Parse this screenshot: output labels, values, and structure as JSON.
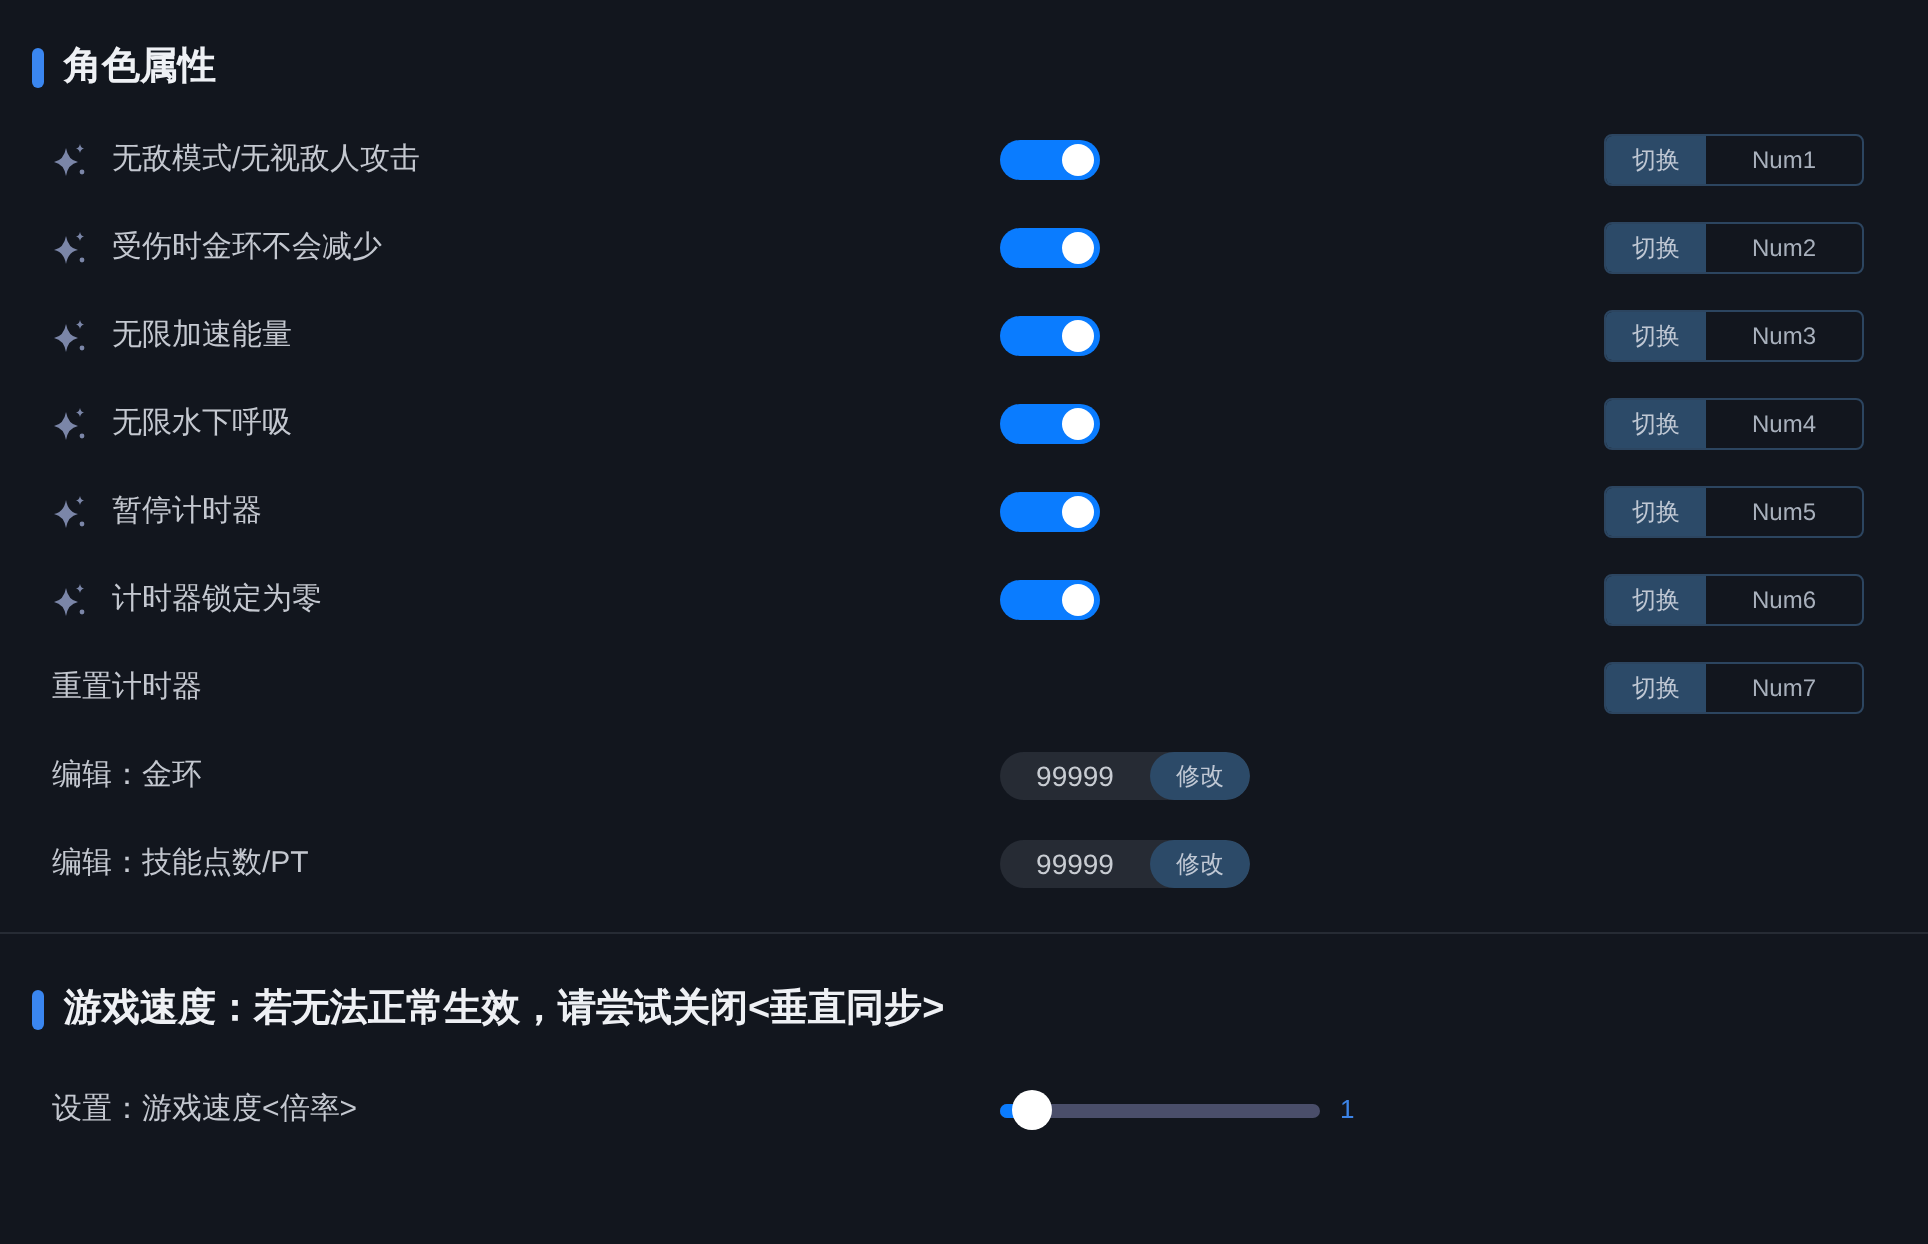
{
  "sections": [
    {
      "title": "角色属性",
      "rows": [
        {
          "kind": "toggle",
          "label": "无敌模式/无视敌人攻击",
          "on": true,
          "hotkey": {
            "action": "切换",
            "key": "Num1"
          }
        },
        {
          "kind": "toggle",
          "label": "受伤时金环不会减少",
          "on": true,
          "hotkey": {
            "action": "切换",
            "key": "Num2"
          }
        },
        {
          "kind": "toggle",
          "label": "无限加速能量",
          "on": true,
          "hotkey": {
            "action": "切换",
            "key": "Num3"
          }
        },
        {
          "kind": "toggle",
          "label": "无限水下呼吸",
          "on": true,
          "hotkey": {
            "action": "切换",
            "key": "Num4"
          }
        },
        {
          "kind": "toggle",
          "label": "暂停计时器",
          "on": true,
          "hotkey": {
            "action": "切换",
            "key": "Num5"
          }
        },
        {
          "kind": "toggle",
          "label": "计时器锁定为零",
          "on": true,
          "hotkey": {
            "action": "切换",
            "key": "Num6"
          }
        },
        {
          "kind": "action",
          "label": "重置计时器",
          "hotkey": {
            "action": "切换",
            "key": "Num7"
          }
        },
        {
          "kind": "edit",
          "label": "编辑：金环",
          "value": "99999",
          "button": "修改"
        },
        {
          "kind": "edit",
          "label": "编辑：技能点数/PT",
          "value": "99999",
          "button": "修改"
        }
      ]
    },
    {
      "title": "游戏速度：若无法正常生效，请尝试关闭<垂直同步>",
      "rows": [
        {
          "kind": "slider",
          "label": "设置：游戏速度<倍率>",
          "level": 0.1,
          "reading": "1"
        }
      ]
    }
  ]
}
